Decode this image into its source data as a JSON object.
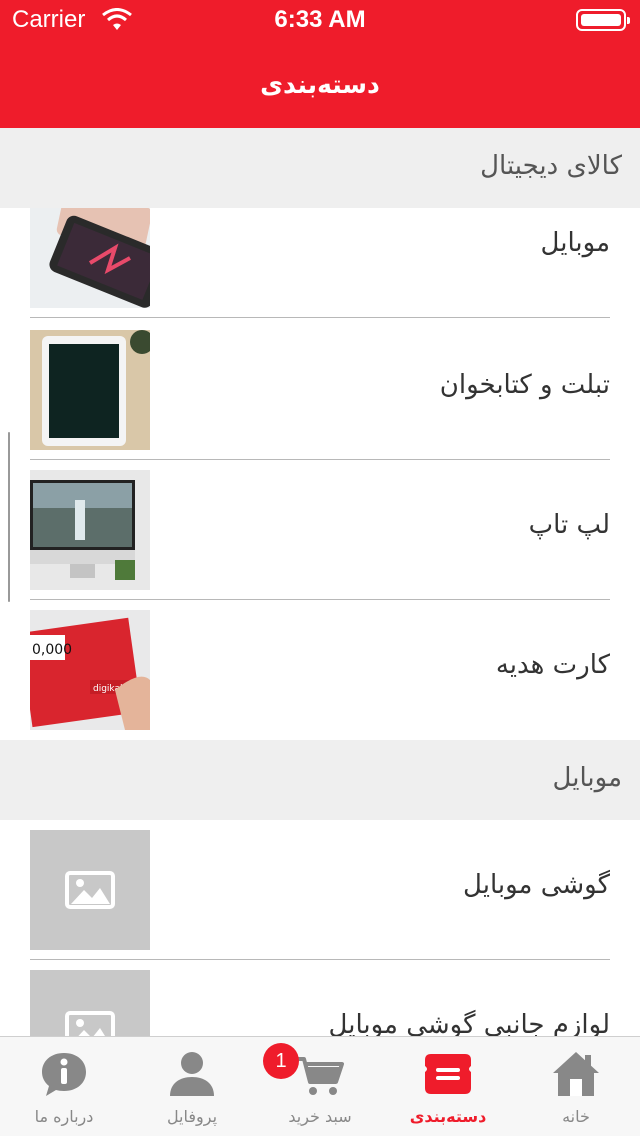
{
  "status_bar": {
    "carrier": "Carrier",
    "time": "6:33 AM"
  },
  "header": {
    "title": "دسته‌بندی"
  },
  "sections": [
    {
      "title": "کالای دیجیتال",
      "items": [
        {
          "label": "موبایل",
          "image": "phone-photo"
        },
        {
          "label": "تبلت و کتابخوان",
          "image": "tablet-photo"
        },
        {
          "label": "لپ تاپ",
          "image": "laptop-photo"
        },
        {
          "label": "کارت هدیه",
          "image": "gift-card-photo",
          "card_brand": "digikala",
          "card_amount": "0,000"
        }
      ]
    },
    {
      "title": "موبایل",
      "items": [
        {
          "label": "گوشی موبایل",
          "image": "image-placeholder-icon"
        },
        {
          "label": "لوازم جانبی گوشی موبایل",
          "image": "image-placeholder-icon"
        }
      ]
    }
  ],
  "tabbar": {
    "tabs": [
      {
        "label": "درباره ما",
        "icon": "info-icon"
      },
      {
        "label": "پروفایل",
        "icon": "user-icon"
      },
      {
        "label": "سبد خرید",
        "icon": "cart-icon"
      },
      {
        "label": "دسته‌بندی",
        "icon": "category-icon"
      },
      {
        "label": "خانه",
        "icon": "home-icon"
      }
    ],
    "cart_badge": "1",
    "active_tab": "دسته‌بندی"
  },
  "colors": {
    "brand": "#ef1c2b",
    "section_bg": "#efefef",
    "inactive_icon": "#888888"
  }
}
